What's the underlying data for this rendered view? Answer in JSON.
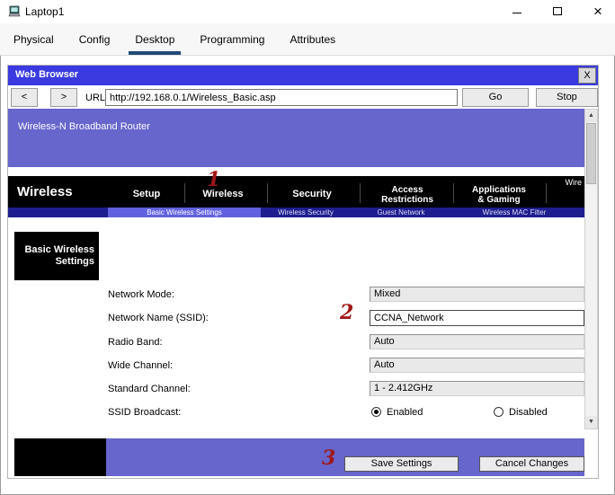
{
  "window": {
    "title": "Laptop1"
  },
  "icons": {
    "close": "×",
    "browser_close": "X",
    "scroll_up": "▲",
    "scroll_down": "▼"
  },
  "tabs": [
    {
      "label": "Physical",
      "active": false
    },
    {
      "label": "Config",
      "active": false
    },
    {
      "label": "Desktop",
      "active": true
    },
    {
      "label": "Programming",
      "active": false
    },
    {
      "label": "Attributes",
      "active": false
    }
  ],
  "browser": {
    "title": "Web Browser",
    "back": "<",
    "forward": ">",
    "url_label": "URL",
    "url": "http://192.168.0.1/Wireless_Basic.asp",
    "go": "Go",
    "stop": "Stop"
  },
  "page": {
    "banner": "Wireless-N Broadband Router",
    "brand_corner": "Wire",
    "section_title": "Wireless",
    "menu": [
      [
        "Setup"
      ],
      [
        "Wireless"
      ],
      [
        "Security"
      ],
      [
        "Access",
        "Restrictions"
      ],
      [
        "Applications",
        "& Gaming"
      ]
    ],
    "submenu": {
      "active": "Basic Wireless Settings",
      "items": [
        "Wireless Security",
        "Guest Network",
        "Wireless MAC Filter"
      ]
    },
    "sidebar": {
      "line1": "Basic Wireless",
      "line2": "Settings"
    },
    "form": {
      "rows": [
        {
          "label": "Network Mode:",
          "value": "Mixed"
        },
        {
          "label": "Network Name (SSID):",
          "value": "CCNA_Network"
        },
        {
          "label": "Radio Band:",
          "value": "Auto"
        },
        {
          "label": "Wide Channel:",
          "value": "Auto"
        },
        {
          "label": "Standard Channel:",
          "value": "1 - 2.412GHz"
        }
      ],
      "broadcast": {
        "label": "SSID Broadcast:",
        "options": [
          {
            "label": "Enabled",
            "selected": true
          },
          {
            "label": "Disabled",
            "selected": false
          }
        ]
      }
    },
    "footer": {
      "save": "Save Settings",
      "cancel": "Cancel Changes"
    }
  },
  "annotations": [
    {
      "text": "1"
    },
    {
      "text": "2"
    },
    {
      "text": "3"
    }
  ],
  "colors": {
    "browser_titlebar": "#3a3ae0",
    "banner_purple": "#6666cc",
    "nav_black": "#000000",
    "submenu_navy": "#1e1e8f",
    "submenu_active": "#6161e0",
    "footer_purple": "#6666cc",
    "annotation_red": "#a01616",
    "tab_underline": "#204a77"
  }
}
